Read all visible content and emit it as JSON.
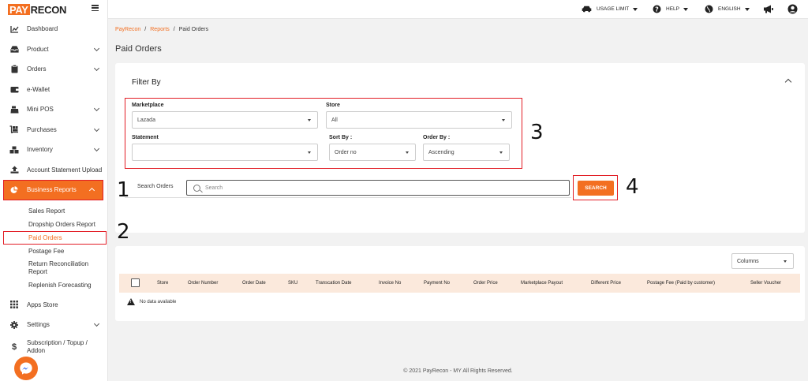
{
  "logo": {
    "part1": "PAY",
    "part2": "RECON"
  },
  "topbar": {
    "usage_limit": "USAGE LIMIT",
    "help": "HELP",
    "language": "ENGLISH"
  },
  "sidebar": {
    "items": [
      {
        "label": "Dashboard",
        "icon": "chart-line-icon"
      },
      {
        "label": "Product",
        "icon": "inbox-icon"
      },
      {
        "label": "Orders",
        "icon": "clipboard-icon"
      },
      {
        "label": "e-Wallet",
        "icon": "wallet-icon"
      },
      {
        "label": "Mini POS",
        "icon": "cash-register-icon"
      },
      {
        "label": "Purchases",
        "icon": "dolly-icon"
      },
      {
        "label": "Inventory",
        "icon": "boxes-icon"
      },
      {
        "label": "Account Statement Upload",
        "icon": "upload-icon"
      },
      {
        "label": "Business Reports",
        "icon": "pie-chart-icon"
      }
    ],
    "subitems": [
      {
        "label": "Sales Report"
      },
      {
        "label": "Dropship Orders Report"
      },
      {
        "label": "Paid Orders"
      },
      {
        "label": "Postage Fee"
      },
      {
        "label": "Return Reconciliation Report"
      },
      {
        "label": "Replenish Forecasting"
      }
    ],
    "bottom_items": [
      {
        "label": "Apps Store",
        "icon": "grid-icon"
      },
      {
        "label": "Settings",
        "icon": "gear-icon"
      },
      {
        "label": "Subscription / Topup / Addon",
        "icon": "dollar-icon"
      }
    ]
  },
  "breadcrumb": {
    "home": "PayRecon",
    "reports": "Reports",
    "sep": "/",
    "current": "Paid Orders"
  },
  "page_title": "Paid Orders",
  "filter": {
    "title": "Filter By",
    "marketplace_label": "Marketplace",
    "marketplace_value": "Lazada",
    "store_label": "Store",
    "store_value": "All",
    "statement_label": "Statement",
    "statement_value": "",
    "sort_by_label": "Sort By :",
    "sort_by_value": "Order no",
    "order_by_label": "Order By :",
    "order_by_value": "Ascending",
    "search_label": "Search Orders",
    "search_placeholder": "Search",
    "search_button": "SEARCH"
  },
  "annotations": [
    "1",
    "2",
    "3",
    "4"
  ],
  "table": {
    "columns_label": "Columns",
    "headers": [
      "Store",
      "Order Number",
      "Order Date",
      "SKU",
      "Transcation Date",
      "Invoice No",
      "Payment No",
      "Order Price",
      "Marketplace Payout",
      "Different Price",
      "Postage Fee (Paid by customer)",
      "Seller Voucher"
    ],
    "empty_text": "No data available"
  },
  "footer": "© 2021 PayRecon - MY All Rights Reserved.",
  "colors": {
    "brand": "#f36f21",
    "highlight": "#e21d25",
    "table_header": "#fbe9dc"
  }
}
